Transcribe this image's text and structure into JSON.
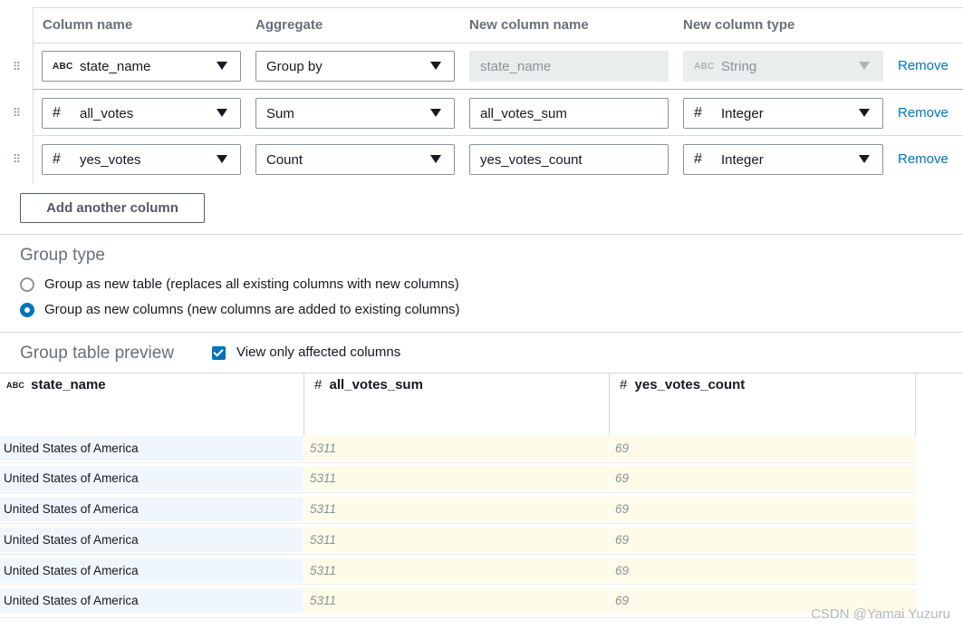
{
  "config": {
    "headers": {
      "column_name": "Column name",
      "aggregate": "Aggregate",
      "new_column_name": "New column name",
      "new_column_type": "New column type"
    },
    "rows": [
      {
        "column_icon": "ABC",
        "column": "state_name",
        "aggregate": "Group by",
        "new_name": "state_name",
        "type_icon": "ABC",
        "type": "String",
        "remove": "Remove",
        "disabled": true
      },
      {
        "column_icon": "#",
        "column": "all_votes",
        "aggregate": "Sum",
        "new_name": "all_votes_sum",
        "type_icon": "#",
        "type": "Integer",
        "remove": "Remove",
        "disabled": false
      },
      {
        "column_icon": "#",
        "column": "yes_votes",
        "aggregate": "Count",
        "new_name": "yes_votes_count",
        "type_icon": "#",
        "type": "Integer",
        "remove": "Remove",
        "disabled": false
      }
    ],
    "add_button": "Add another column"
  },
  "group_type": {
    "title": "Group type",
    "options": [
      {
        "label": "Group as new table (replaces all existing columns with new columns)",
        "selected": false
      },
      {
        "label": "Group as new columns (new columns are added to existing columns)",
        "selected": true
      }
    ]
  },
  "preview": {
    "title": "Group table preview",
    "affected_only_label": "View only affected columns",
    "affected_only_checked": true,
    "columns": [
      {
        "icon": "ABC",
        "name": "state_name"
      },
      {
        "icon": "#",
        "name": "all_votes_sum"
      },
      {
        "icon": "#",
        "name": "yes_votes_count"
      }
    ],
    "rows": [
      [
        "United States of America",
        "5311",
        "69"
      ],
      [
        "United States of America",
        "5311",
        "69"
      ],
      [
        "United States of America",
        "5311",
        "69"
      ],
      [
        "United States of America",
        "5311",
        "69"
      ],
      [
        "United States of America",
        "5311",
        "69"
      ],
      [
        "United States of America",
        "5311",
        "69"
      ]
    ]
  },
  "watermark": "CSDN @Yamai Yuzuru",
  "colors": {
    "accent": "#0073bb",
    "preview_key_bg": "#f0f7fc",
    "preview_value_bg": "#fefbe9"
  }
}
